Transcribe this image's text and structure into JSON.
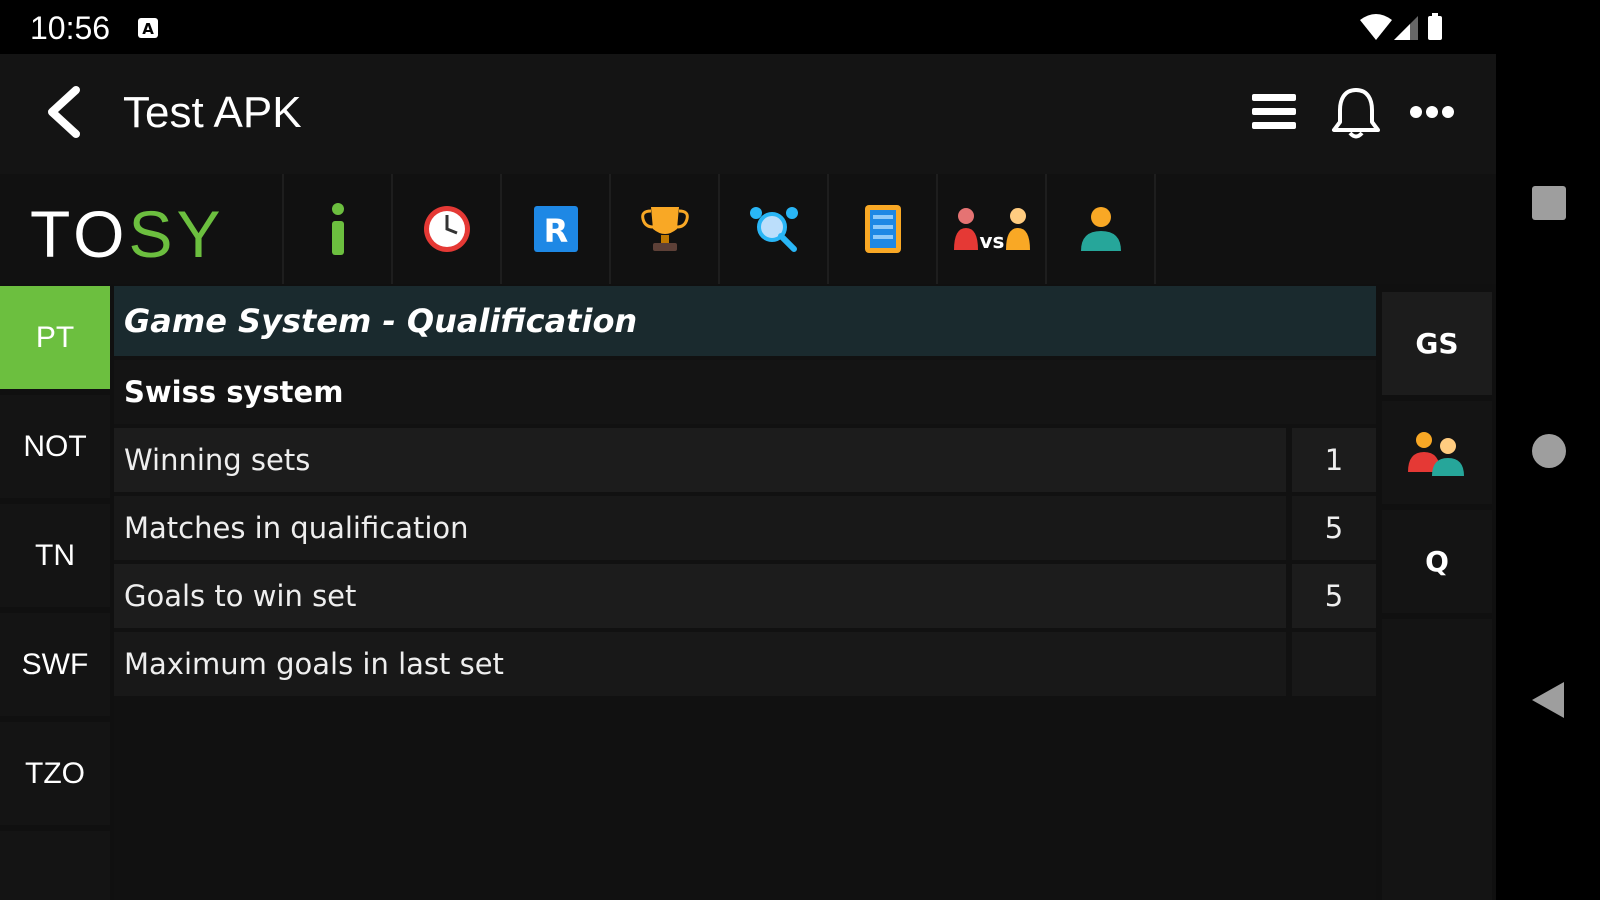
{
  "status_bar": {
    "time": "10:56",
    "icons": [
      "a-icon",
      "wifi-icon",
      "signal-icon",
      "battery-icon"
    ]
  },
  "app_bar": {
    "title": "Test APK",
    "icons": [
      "back-arrow-icon",
      "hamburger-menu-icon",
      "bell-icon",
      "more-dots-icon"
    ]
  },
  "toolbar": {
    "logo": {
      "part1": "TO",
      "part2": "SY"
    },
    "items": [
      {
        "icon": "info-icon"
      },
      {
        "icon": "clock-icon"
      },
      {
        "icon": "r-badge-icon"
      },
      {
        "icon": "trophy-icon"
      },
      {
        "icon": "search-players-icon"
      },
      {
        "icon": "scoreboard-icon"
      },
      {
        "icon": "versus-icon",
        "text": "vs"
      },
      {
        "icon": "person-icon"
      }
    ]
  },
  "left_nav": {
    "items": [
      {
        "label": "PT",
        "active": true
      },
      {
        "label": "NOT",
        "active": false
      },
      {
        "label": "TN",
        "active": false
      },
      {
        "label": "SWF",
        "active": false
      },
      {
        "label": "TZO",
        "active": false
      }
    ]
  },
  "main": {
    "header": "Game System - Qualification",
    "subheader": "Swiss system",
    "rows": [
      {
        "label": "Winning sets",
        "value": "1"
      },
      {
        "label": "Matches in qualification",
        "value": "5"
      },
      {
        "label": "Goals to win set",
        "value": "5"
      },
      {
        "label": "Maximum goals in last set",
        "value": ""
      }
    ]
  },
  "right_nav": {
    "items": [
      {
        "label": "GS",
        "active": true
      },
      {
        "icon": "team-icon"
      },
      {
        "label": "Q"
      }
    ]
  },
  "colors": {
    "accent_green": "#6cbf3f",
    "header_bg": "#1a2a2e",
    "background": "#101010"
  }
}
